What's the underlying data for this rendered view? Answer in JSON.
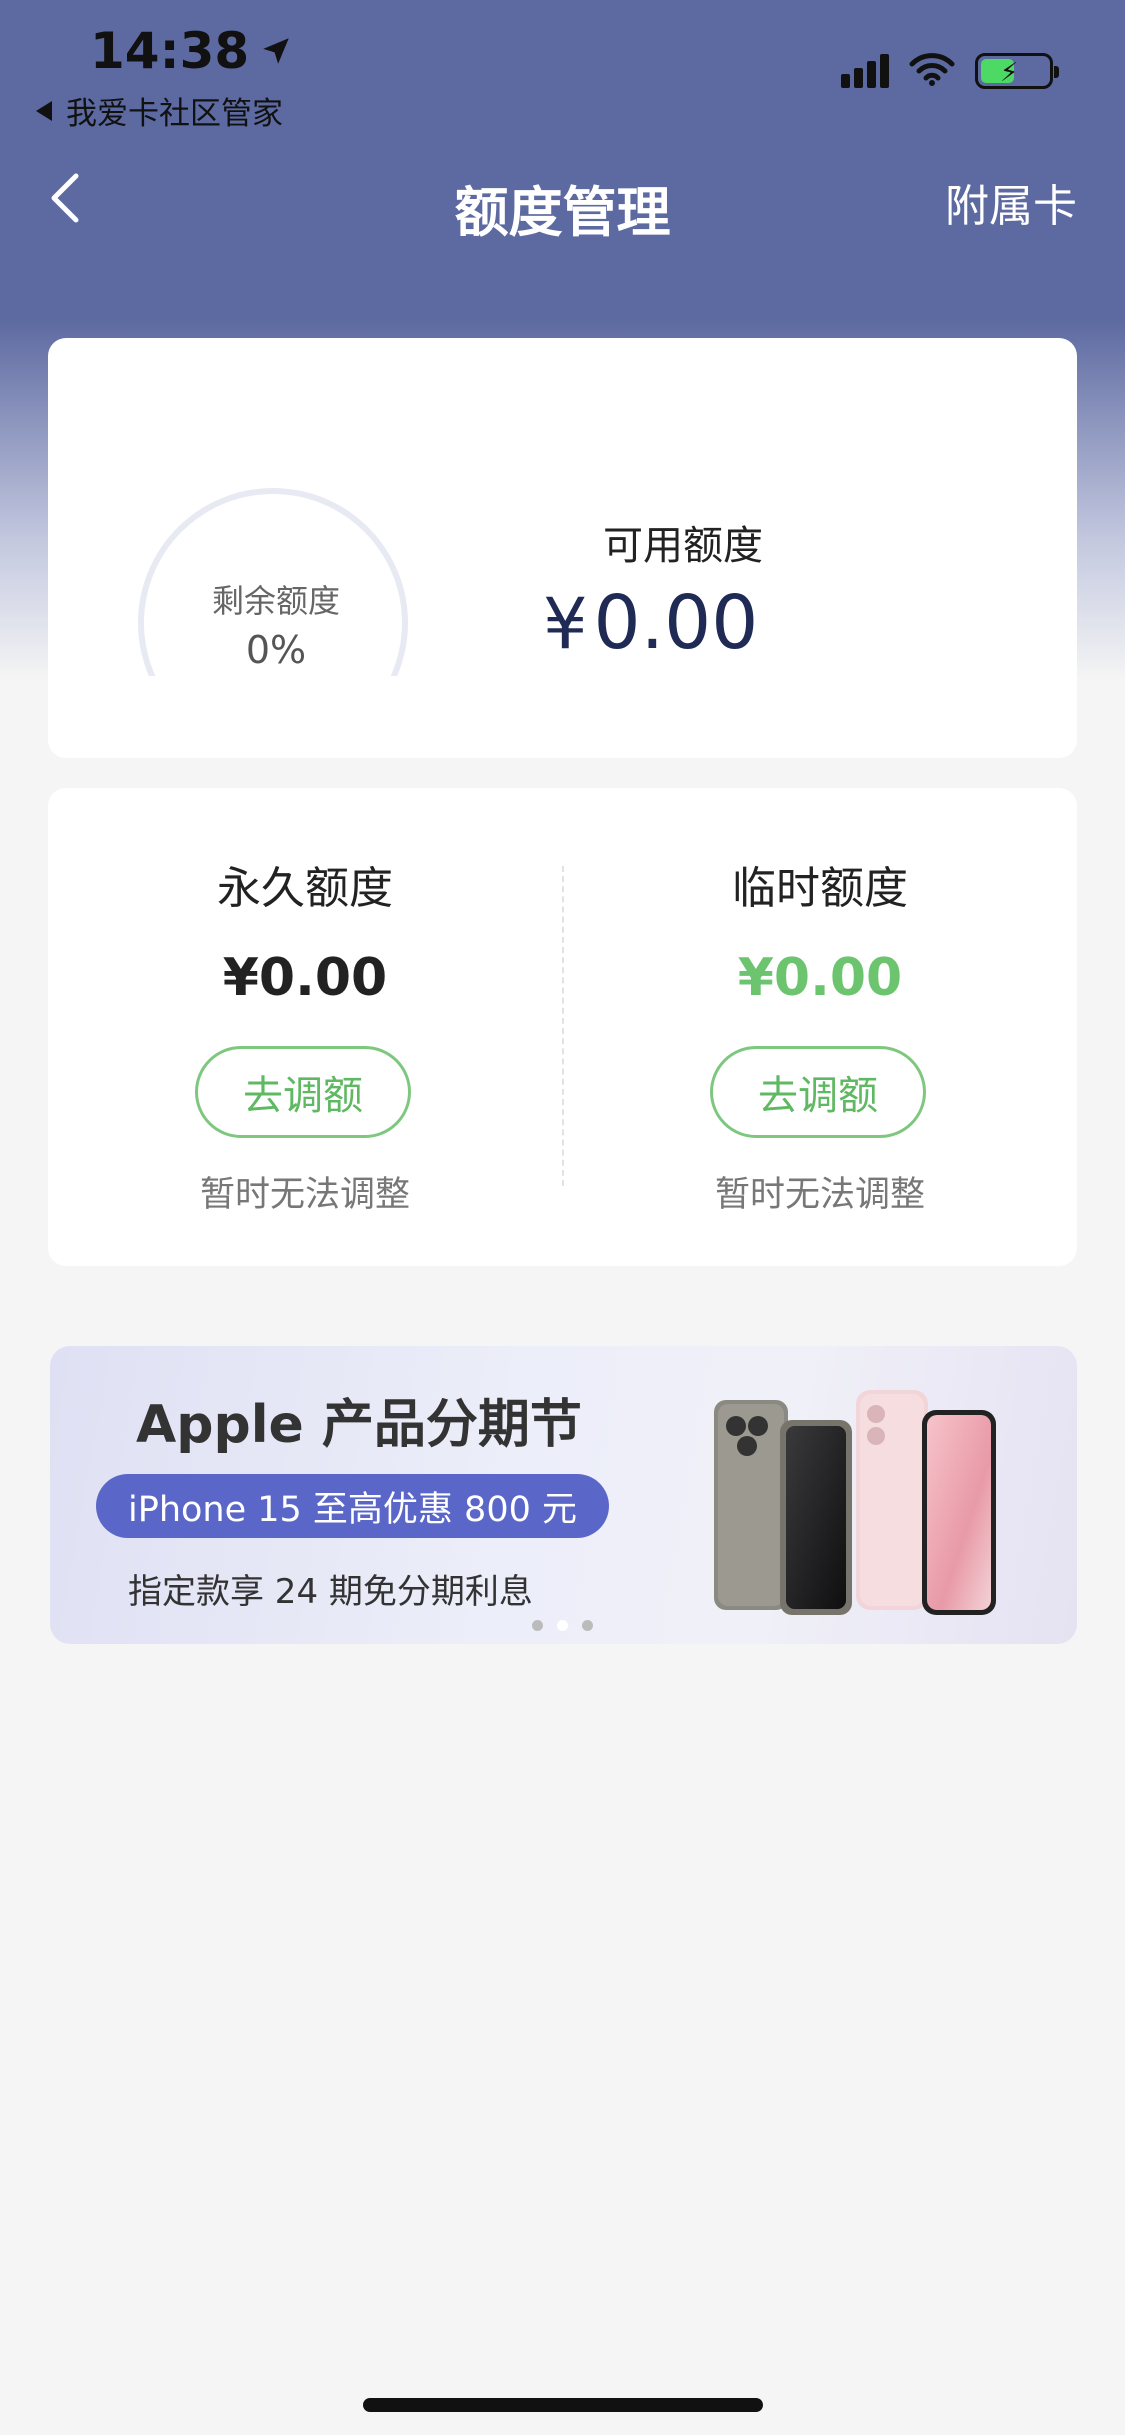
{
  "status_bar": {
    "time": "14:38",
    "back_app": "我爱卡社区管家"
  },
  "nav": {
    "title": "额度管理",
    "right_action": "附属卡"
  },
  "summary": {
    "gauge_label": "剩余额度",
    "gauge_percent": "0%",
    "gauge_fraction": 0,
    "available_label": "可用额度",
    "available_currency": "¥",
    "available_value": "0.00"
  },
  "limits": {
    "permanent": {
      "title": "永久额度",
      "value": "¥0.00",
      "button": "去调额",
      "note": "暂时无法调整"
    },
    "temporary": {
      "title": "临时额度",
      "value": "¥0.00",
      "button": "去调额",
      "note": "暂时无法调整"
    }
  },
  "banner": {
    "title": "Apple 产品分期节",
    "pill": "iPhone 15 至高优惠 800 元",
    "subtitle": "指定款享 24 期免分期利息",
    "dots": 3,
    "active_dot": 1
  },
  "colors": {
    "header_bg": "#5d6aa1",
    "green": "#6cc46f",
    "amount_dark": "#1f2a55",
    "pill_bg": "#5b67c8"
  }
}
